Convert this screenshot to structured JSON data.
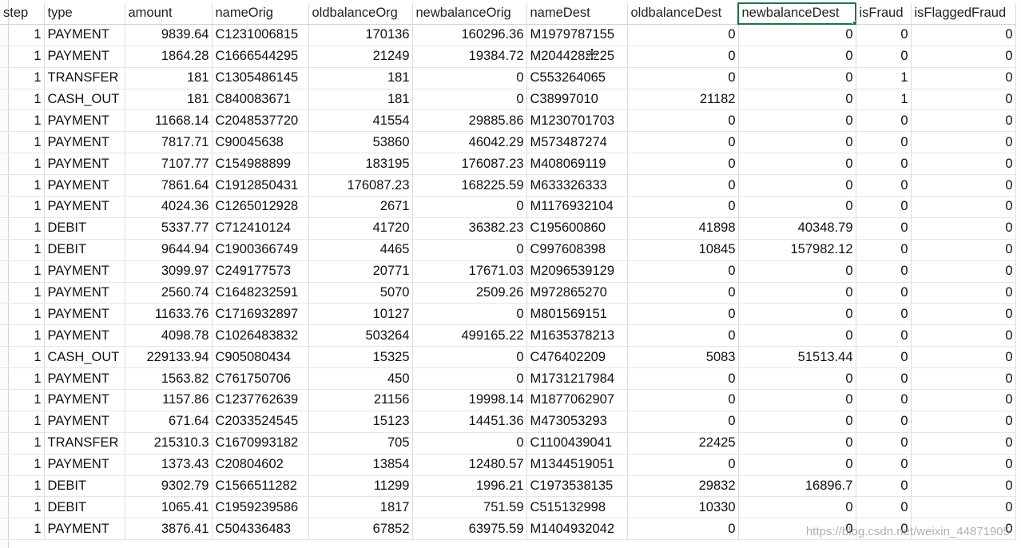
{
  "sheet": {
    "headers": [
      "step",
      "type",
      "amount",
      "nameOrig",
      "oldbalanceOrg",
      "newbalanceOrig",
      "nameDest",
      "oldbalanceDest",
      "newbalanceDest",
      "isFraud",
      "isFlaggedFraud"
    ],
    "rows": [
      [
        "1",
        "PAYMENT",
        "9839.64",
        "C1231006815",
        "170136",
        "160296.36",
        "M1979787155",
        "0",
        "0",
        "0",
        "0"
      ],
      [
        "1",
        "PAYMENT",
        "1864.28",
        "C1666544295",
        "21249",
        "19384.72",
        "M2044282225",
        "0",
        "0",
        "0",
        "0"
      ],
      [
        "1",
        "TRANSFER",
        "181",
        "C1305486145",
        "181",
        "0",
        "C553264065",
        "0",
        "0",
        "1",
        "0"
      ],
      [
        "1",
        "CASH_OUT",
        "181",
        "C840083671",
        "181",
        "0",
        "C38997010",
        "21182",
        "0",
        "1",
        "0"
      ],
      [
        "1",
        "PAYMENT",
        "11668.14",
        "C2048537720",
        "41554",
        "29885.86",
        "M1230701703",
        "0",
        "0",
        "0",
        "0"
      ],
      [
        "1",
        "PAYMENT",
        "7817.71",
        "C90045638",
        "53860",
        "46042.29",
        "M573487274",
        "0",
        "0",
        "0",
        "0"
      ],
      [
        "1",
        "PAYMENT",
        "7107.77",
        "C154988899",
        "183195",
        "176087.23",
        "M408069119",
        "0",
        "0",
        "0",
        "0"
      ],
      [
        "1",
        "PAYMENT",
        "7861.64",
        "C1912850431",
        "176087.23",
        "168225.59",
        "M633326333",
        "0",
        "0",
        "0",
        "0"
      ],
      [
        "1",
        "PAYMENT",
        "4024.36",
        "C1265012928",
        "2671",
        "0",
        "M1176932104",
        "0",
        "0",
        "0",
        "0"
      ],
      [
        "1",
        "DEBIT",
        "5337.77",
        "C712410124",
        "41720",
        "36382.23",
        "C195600860",
        "41898",
        "40348.79",
        "0",
        "0"
      ],
      [
        "1",
        "DEBIT",
        "9644.94",
        "C1900366749",
        "4465",
        "0",
        "C997608398",
        "10845",
        "157982.12",
        "0",
        "0"
      ],
      [
        "1",
        "PAYMENT",
        "3099.97",
        "C249177573",
        "20771",
        "17671.03",
        "M2096539129",
        "0",
        "0",
        "0",
        "0"
      ],
      [
        "1",
        "PAYMENT",
        "2560.74",
        "C1648232591",
        "5070",
        "2509.26",
        "M972865270",
        "0",
        "0",
        "0",
        "0"
      ],
      [
        "1",
        "PAYMENT",
        "11633.76",
        "C1716932897",
        "10127",
        "0",
        "M801569151",
        "0",
        "0",
        "0",
        "0"
      ],
      [
        "1",
        "PAYMENT",
        "4098.78",
        "C1026483832",
        "503264",
        "499165.22",
        "M1635378213",
        "0",
        "0",
        "0",
        "0"
      ],
      [
        "1",
        "CASH_OUT",
        "229133.94",
        "C905080434",
        "15325",
        "0",
        "C476402209",
        "5083",
        "51513.44",
        "0",
        "0"
      ],
      [
        "1",
        "PAYMENT",
        "1563.82",
        "C761750706",
        "450",
        "0",
        "M1731217984",
        "0",
        "0",
        "0",
        "0"
      ],
      [
        "1",
        "PAYMENT",
        "1157.86",
        "C1237762639",
        "21156",
        "19998.14",
        "M1877062907",
        "0",
        "0",
        "0",
        "0"
      ],
      [
        "1",
        "PAYMENT",
        "671.64",
        "C2033524545",
        "15123",
        "14451.36",
        "M473053293",
        "0",
        "0",
        "0",
        "0"
      ],
      [
        "1",
        "TRANSFER",
        "215310.3",
        "C1670993182",
        "705",
        "0",
        "C1100439041",
        "22425",
        "0",
        "0",
        "0"
      ],
      [
        "1",
        "PAYMENT",
        "1373.43",
        "C20804602",
        "13854",
        "12480.57",
        "M1344519051",
        "0",
        "0",
        "0",
        "0"
      ],
      [
        "1",
        "DEBIT",
        "9302.79",
        "C1566511282",
        "11299",
        "1996.21",
        "C1973538135",
        "29832",
        "16896.7",
        "0",
        "0"
      ],
      [
        "1",
        "DEBIT",
        "1065.41",
        "C1959239586",
        "1817",
        "751.59",
        "C515132998",
        "10330",
        "0",
        "0",
        "0"
      ],
      [
        "1",
        "PAYMENT",
        "3876.41",
        "C504336483",
        "67852",
        "63975.59",
        "M1404932042",
        "0",
        "0",
        "0",
        "0"
      ]
    ],
    "selected_cell": "newbalanceDest"
  },
  "watermark": "https://blog.csdn.net/weixin_44871905",
  "colors": {
    "selection": "#217346",
    "gridline": "#dcdcdc"
  },
  "icons": {
    "cursor": "move-cursor-icon"
  }
}
